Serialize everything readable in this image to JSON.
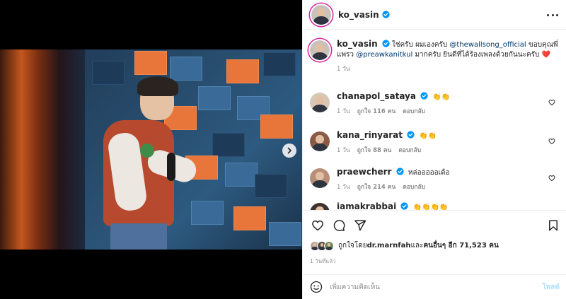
{
  "post": {
    "author": "ko_vasin",
    "caption": {
      "text_before": "ใช่ครับ ผมเองครับ ",
      "mention1": "@thewallsong_official",
      "text_mid": " ขอบคุณพี่แพรว ",
      "mention2": "@preawkanitkul",
      "text_after": " มากครับ ยินดีที่ได้ร้องเพลงด้วยกันนะครับ ",
      "heart": "❤️",
      "age": "1 วัน"
    },
    "slide_count": 3,
    "active_slide": 1
  },
  "comments": [
    {
      "user": "chanapol_sataya",
      "text": "👏👏",
      "age": "1 วัน",
      "likes": "ถูกใจ 116 คน",
      "reply": "ตอบกลับ"
    },
    {
      "user": "kana_rinyarat",
      "text": "👏👏",
      "age": "1 วัน",
      "likes": "ถูกใจ 88 คน",
      "reply": "ตอบกลับ"
    },
    {
      "user": "praewcherr",
      "text": "หล่อออออเด้อ",
      "age": "1 วัน",
      "likes": "ถูกใจ 214 คน",
      "reply": "ตอบกลับ"
    },
    {
      "user": "iamakrabbai",
      "text": "👏👏👏👏"
    }
  ],
  "likes": {
    "prefix": "ถูกใจโดย ",
    "first_user": "dr.marnfah",
    "mid": " และ",
    "others": "คนอื่นๆ อีก 71,523 คน"
  },
  "timestamp": "1 วันที่แล้ว",
  "composer": {
    "placeholder": "เพิ่มความคิดเห็น",
    "post_label": "โพสต์"
  },
  "colors": {
    "verified": "#0095f6",
    "heart": "#ed4956",
    "story_ring": "#d6249f",
    "mention": "#00376b",
    "post_disabled": "#b2dffc"
  }
}
